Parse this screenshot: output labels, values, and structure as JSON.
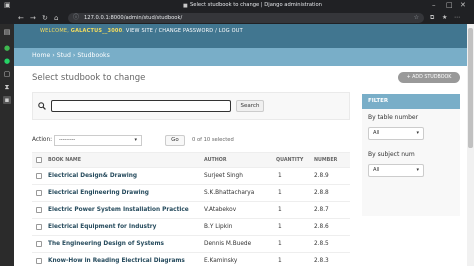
{
  "browser": {
    "window_title": "Select studbook to change | Django administration",
    "url": "127.0.0.1:8000/admin/stud/studbook/"
  },
  "header": {
    "welcome": "WELCOME,",
    "username": "GALACTUS__3000",
    "view_site": "VIEW SITE",
    "change_password": "CHANGE PASSWORD",
    "log_out": "LOG OUT",
    "separator": "/"
  },
  "breadcrumbs": {
    "home": "Home",
    "app": "Stud",
    "model": "Studbooks",
    "sep": "›"
  },
  "main": {
    "title": "Select studbook to change",
    "add_button": "ADD STUDBOOK",
    "search_button": "Search",
    "search_value": ""
  },
  "actions": {
    "label": "Action:",
    "selected": "---------",
    "go": "Go",
    "counter": "0 of 10 selected"
  },
  "table": {
    "columns": [
      "BOOK NAME",
      "AUTHOR",
      "QUANTITY",
      "NUMBER"
    ],
    "rows": [
      {
        "name": "Electrical Design& Drawing",
        "author": "Surjeet Singh",
        "quantity": "1",
        "number": "2.8.9"
      },
      {
        "name": "Electrical Engineering Drawing",
        "author": "S.K.Bhattacharya",
        "quantity": "1",
        "number": "2.8.8"
      },
      {
        "name": "Electric Power System Installation Practice",
        "author": "V.Atabekov",
        "quantity": "1",
        "number": "2.8.7"
      },
      {
        "name": "Electrical Equipment for Industry",
        "author": "B.Y Lipkin",
        "quantity": "1",
        "number": "2.8.6"
      },
      {
        "name": "The Engineering Design of Systems",
        "author": "Dennis M.Buede",
        "quantity": "1",
        "number": "2.8.5"
      },
      {
        "name": "Know-How in Reading Electrical Diagrams",
        "author": "E.Kaminsky",
        "quantity": "1",
        "number": "2.8.3"
      }
    ]
  },
  "filter": {
    "title": "FILTER",
    "by_table_number": "By table number",
    "table_number_value": "All",
    "by_subject_num": "By subject num",
    "subject_num_value": "All"
  },
  "colors": {
    "header": "#417690",
    "breadcrumbs": "#79aec8",
    "link": "#264b5d",
    "welcome": "#f5dd5d"
  }
}
